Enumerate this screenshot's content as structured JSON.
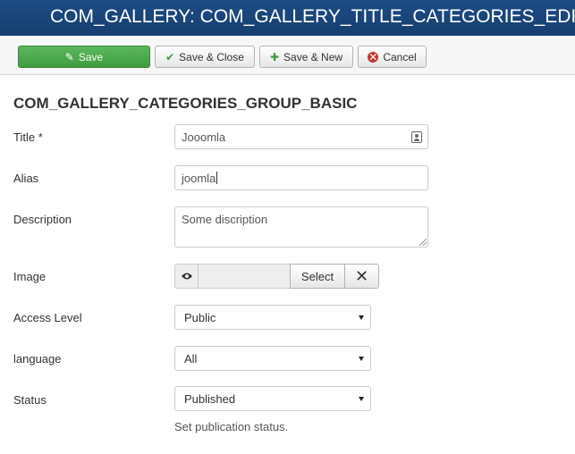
{
  "header": {
    "title": "COM_GALLERY: COM_GALLERY_TITLE_CATEGORIES_EDIT"
  },
  "toolbar": {
    "save_label": "Save",
    "save_close_label": "Save & Close",
    "save_new_label": "Save & New",
    "cancel_label": "Cancel"
  },
  "form": {
    "section_title": "COM_GALLERY_CATEGORIES_GROUP_BASIC",
    "title": {
      "label": "Title *",
      "value": "Jooomla"
    },
    "alias": {
      "label": "Alias",
      "value": "joomla"
    },
    "description": {
      "label": "Description",
      "value": "Some discription"
    },
    "image": {
      "label": "Image",
      "select_label": "Select",
      "clear_label": "✕"
    },
    "access": {
      "label": "Access Level",
      "value": "Public"
    },
    "language": {
      "label": "language",
      "value": "All"
    },
    "status": {
      "label": "Status",
      "value": "Published",
      "help": "Set publication status."
    }
  },
  "colors": {
    "header_bg": "#1d4b84",
    "save_bg": "#4cae4c",
    "cancel_icon": "#c0392b"
  },
  "icons": {
    "save": "edit-icon",
    "save_close": "check-icon",
    "save_new": "plus-icon",
    "cancel": "cancel-circle-icon",
    "title_field": "contact-card-icon",
    "image_preview": "eye-icon",
    "image_clear": "close-icon"
  }
}
